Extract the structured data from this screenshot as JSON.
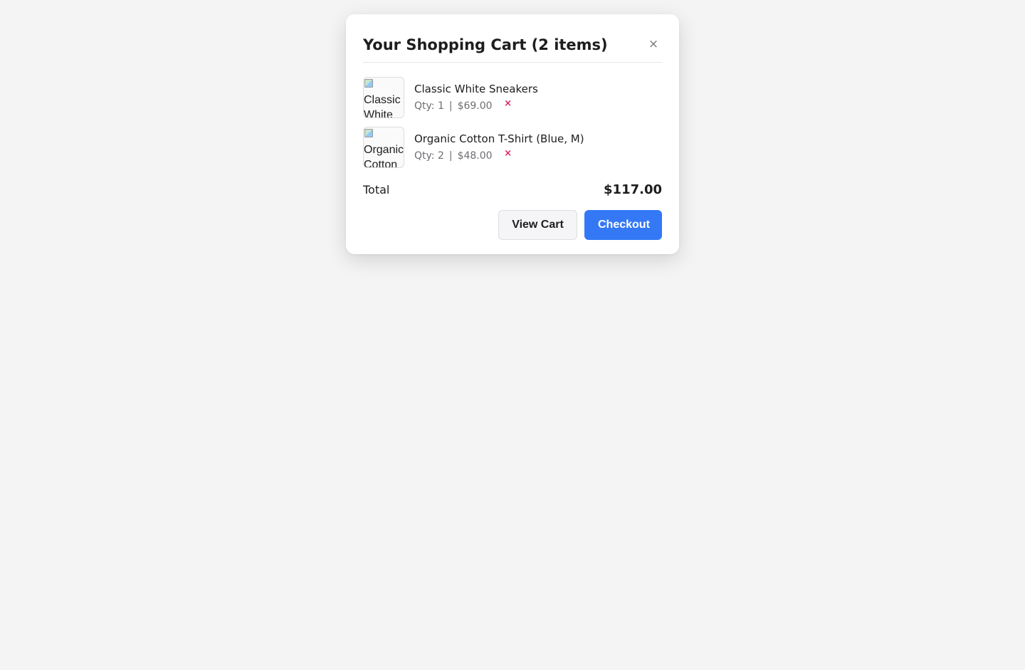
{
  "cart": {
    "title": "Your Shopping Cart (2 items)",
    "close_label": "×",
    "items": [
      {
        "image_alt": "Classic White Sneakers",
        "name": "Classic White Sneakers",
        "qty_text": "Qty: 1",
        "separator": "|",
        "price": "$69.00",
        "remove_label": "×"
      },
      {
        "image_alt": "Organic Cotton T-Shirt",
        "name": "Organic Cotton T-Shirt (Blue, M)",
        "qty_text": "Qty: 2",
        "separator": "|",
        "price": "$48.00",
        "remove_label": "×"
      }
    ],
    "total_label": "Total",
    "total_value": "$117.00",
    "actions": {
      "view_cart_label": "View Cart",
      "checkout_label": "Checkout"
    }
  },
  "colors": {
    "page_background": "#f4f4f4",
    "primary_button": "#3478f6",
    "remove_icon": "#e0245e",
    "muted_text": "#6e6e73"
  }
}
